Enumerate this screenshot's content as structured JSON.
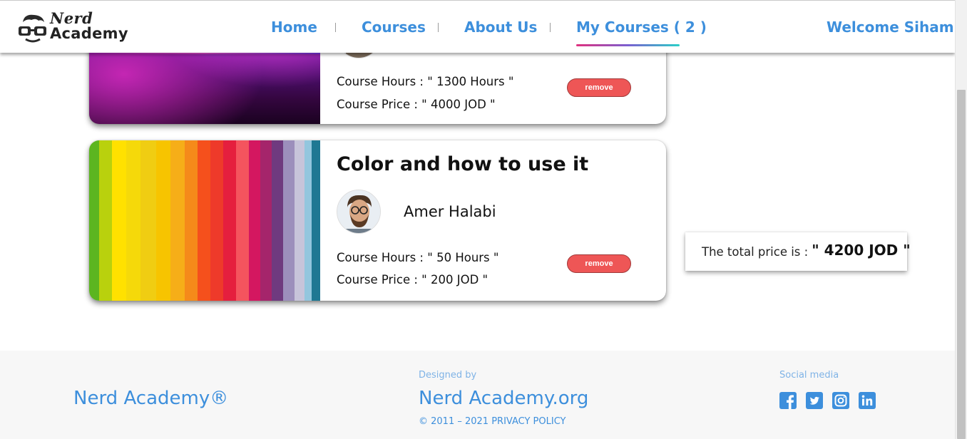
{
  "header": {
    "logo_line1": "Nerd",
    "logo_line2": "Academy",
    "nav": {
      "home": "Home",
      "courses": "Courses",
      "about": "About Us",
      "my_courses": "My Courses ( 2 )"
    },
    "welcome": "Welcome Siham"
  },
  "courses": [
    {
      "title": "",
      "instructor": "",
      "hours": "Course Hours : \" 1300 Hours \"",
      "price": "Course Price : \" 4000 JOD \"",
      "remove_label": "remove"
    },
    {
      "title": "Color and how to use it",
      "instructor": "Amer Halabi",
      "hours": "Course Hours : \" 50 Hours \"",
      "price": "Course Price : \" 200 JOD \"",
      "remove_label": "remove"
    }
  ],
  "total": {
    "label": "The total price is :",
    "value": "\" 4200 JOD \""
  },
  "footer": {
    "brand": "Nerd Academy®",
    "designed_by": "Designed by",
    "site": "Nerd Academy.org",
    "copyright": "© 2011 – 2021 PRIVACY POLICY",
    "social_label": "Social media",
    "social_icons": [
      "facebook-icon",
      "twitter-icon",
      "instagram-icon",
      "linkedin-icon"
    ]
  },
  "colors": {
    "accent": "#3d8fdc",
    "remove": "#ee5656"
  }
}
